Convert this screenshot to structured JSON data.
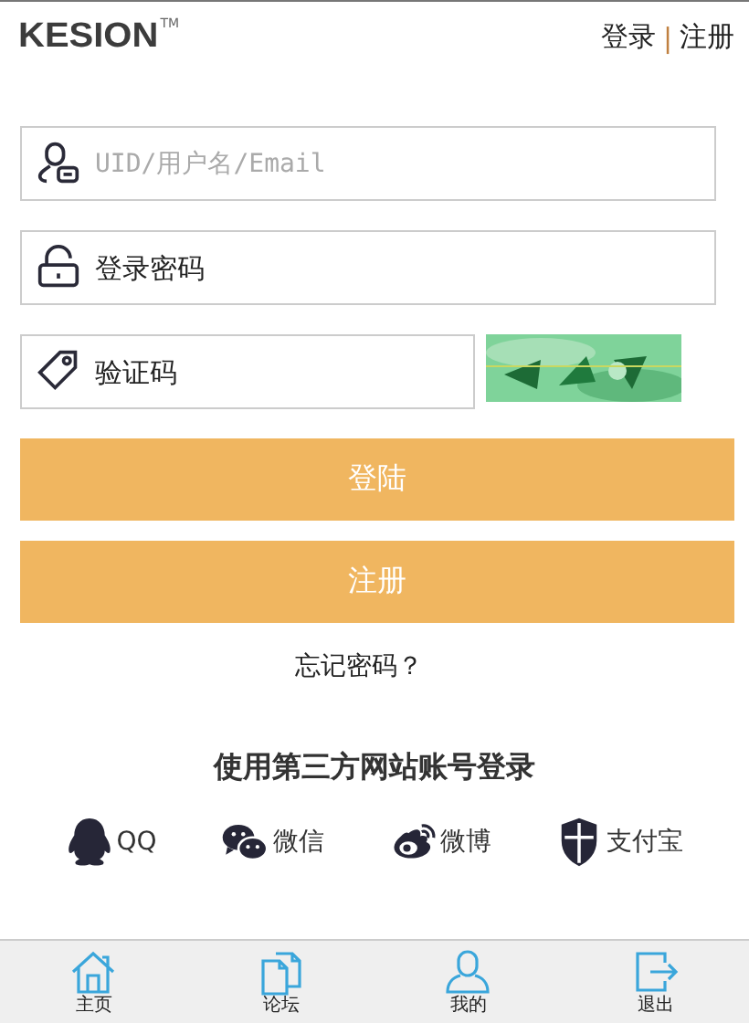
{
  "header": {
    "logo": "KESION",
    "trademark": "TM",
    "links": [
      {
        "label": "登录"
      },
      {
        "label": "注册"
      }
    ],
    "separator": "|"
  },
  "fields": [
    {
      "kind": "user",
      "placeholder": "UID/用户名/Email"
    },
    {
      "kind": "password",
      "placeholder": "登录密码"
    },
    {
      "kind": "captcha",
      "placeholder": "验证码"
    }
  ],
  "buttons": [
    "登陆",
    "注册"
  ],
  "forgot_link": "忘记密码？",
  "third_party": {
    "title": "使用第三方网站账号登录",
    "items": [
      {
        "kind": "qq",
        "label": "QQ"
      },
      {
        "kind": "wechat",
        "label": "微信"
      },
      {
        "kind": "weibo",
        "label": "微博"
      },
      {
        "kind": "alipay",
        "label": "支付宝"
      }
    ]
  },
  "bottom_nav": [
    {
      "kind": "home",
      "label": "主页"
    },
    {
      "kind": "forum",
      "label": "论坛"
    },
    {
      "kind": "me",
      "label": "我的"
    },
    {
      "kind": "logout",
      "label": "退出"
    }
  ]
}
